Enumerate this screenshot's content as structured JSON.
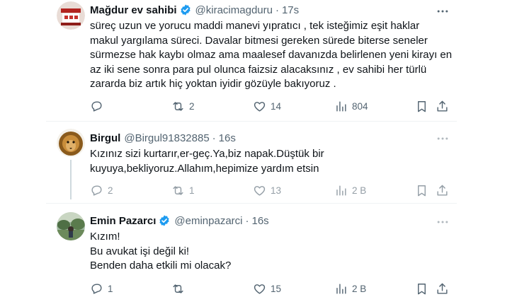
{
  "tweets": [
    {
      "name": "Mağdur ev sahibi",
      "verified": true,
      "handle": "@kiracimagduru",
      "time": "17s",
      "text": "süreç uzun ve yorucu maddi manevi yıpratıcı , tek isteğimiz eşit haklar\nmakul yargılama süreci. Davalar bitmesi gereken sürede biterse seneler\nsürmezse hak kaybı olmaz ama maalesef davanızda belirlenen yeni kirayı en\naz iki sene sonra para pul olunca faizsiz alacaksınız , ev sahibi her türlü\nzararda biz artık hiç yoktan iyidir gözüyle bakıyoruz .",
      "replies": "",
      "retweets": "2",
      "likes": "14",
      "views": "804"
    },
    {
      "name": "Birgul",
      "verified": false,
      "handle": "@Birgul91832885",
      "time": "16s",
      "text": "Kızınız sizi kurtarır,er-geç.Ya,biz napak.Düştük bir\nkuyuya,bekliyoruz.Allahım,hepimize yardım etsin",
      "replies": "2",
      "retweets": "1",
      "likes": "13",
      "views": "2 B"
    },
    {
      "name": "Emin Pazarcı",
      "verified": true,
      "handle": "@eminpazarci",
      "time": "16s",
      "text": "Kızım!\nBu avukat işi değil ki!\nBenden daha etkili mi olacak?",
      "replies": "1",
      "retweets": "",
      "likes": "15",
      "views": "2 B"
    }
  ],
  "icons": {
    "reply": "reply-icon",
    "retweet": "retweet-icon",
    "like": "heart-icon",
    "views": "views-icon",
    "bookmark": "bookmark-icon",
    "share": "share-icon",
    "more": "more-icon",
    "verified": "verified-badge-icon"
  },
  "colors": {
    "verified": "#1d9bf0",
    "text": "#0f1419",
    "secondary": "#536471"
  }
}
